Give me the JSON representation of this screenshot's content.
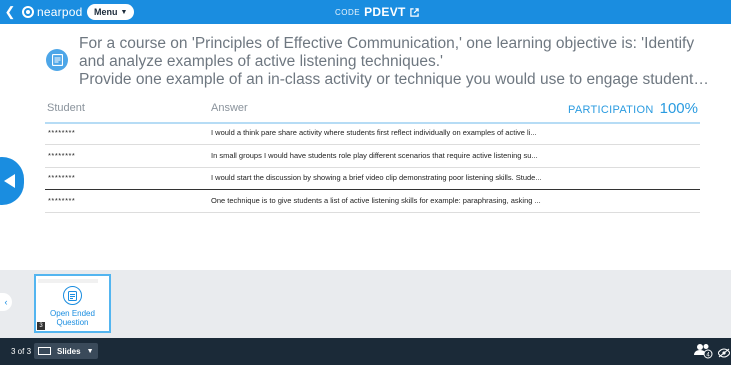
{
  "topbar": {
    "logo_text": "nearpod",
    "menu_label": "Menu",
    "code_label": "CODE",
    "code_value": "PDEVT"
  },
  "question": {
    "text": "For a course on 'Principles of Effective Communication,' one learning objective is: 'Identify and analyze examples of active listening techniques.'",
    "prompt": "Provide one example of an in-class activity or technique you would use to engage students in ..."
  },
  "table": {
    "col_student": "Student",
    "col_answer": "Answer",
    "participation_label": "PARTICIPATION",
    "participation_value": "100%",
    "rows": [
      {
        "student": "********",
        "answer": "I would a think pare share activity where students first reflect individually on examples of active li..."
      },
      {
        "student": "********",
        "answer": "In small groups I would have students role play different scenarios that require active listening su..."
      },
      {
        "student": "********",
        "answer": "I would start the discussion by showing a brief video clip demonstrating poor listening skills. Stude..."
      },
      {
        "student": "********",
        "answer": "One technique is to give students a list of active listening skills for example: paraphrasing, asking ..."
      }
    ]
  },
  "thumbnail": {
    "label": "Open Ended Question",
    "number": "3"
  },
  "bottombar": {
    "page_count": "3 of 3",
    "slides_label": "Slides",
    "students_count": "4"
  },
  "colors": {
    "primary": "#1a8de0",
    "dark_bar": "#1b2a38",
    "strip_bg": "#e9ebee"
  }
}
